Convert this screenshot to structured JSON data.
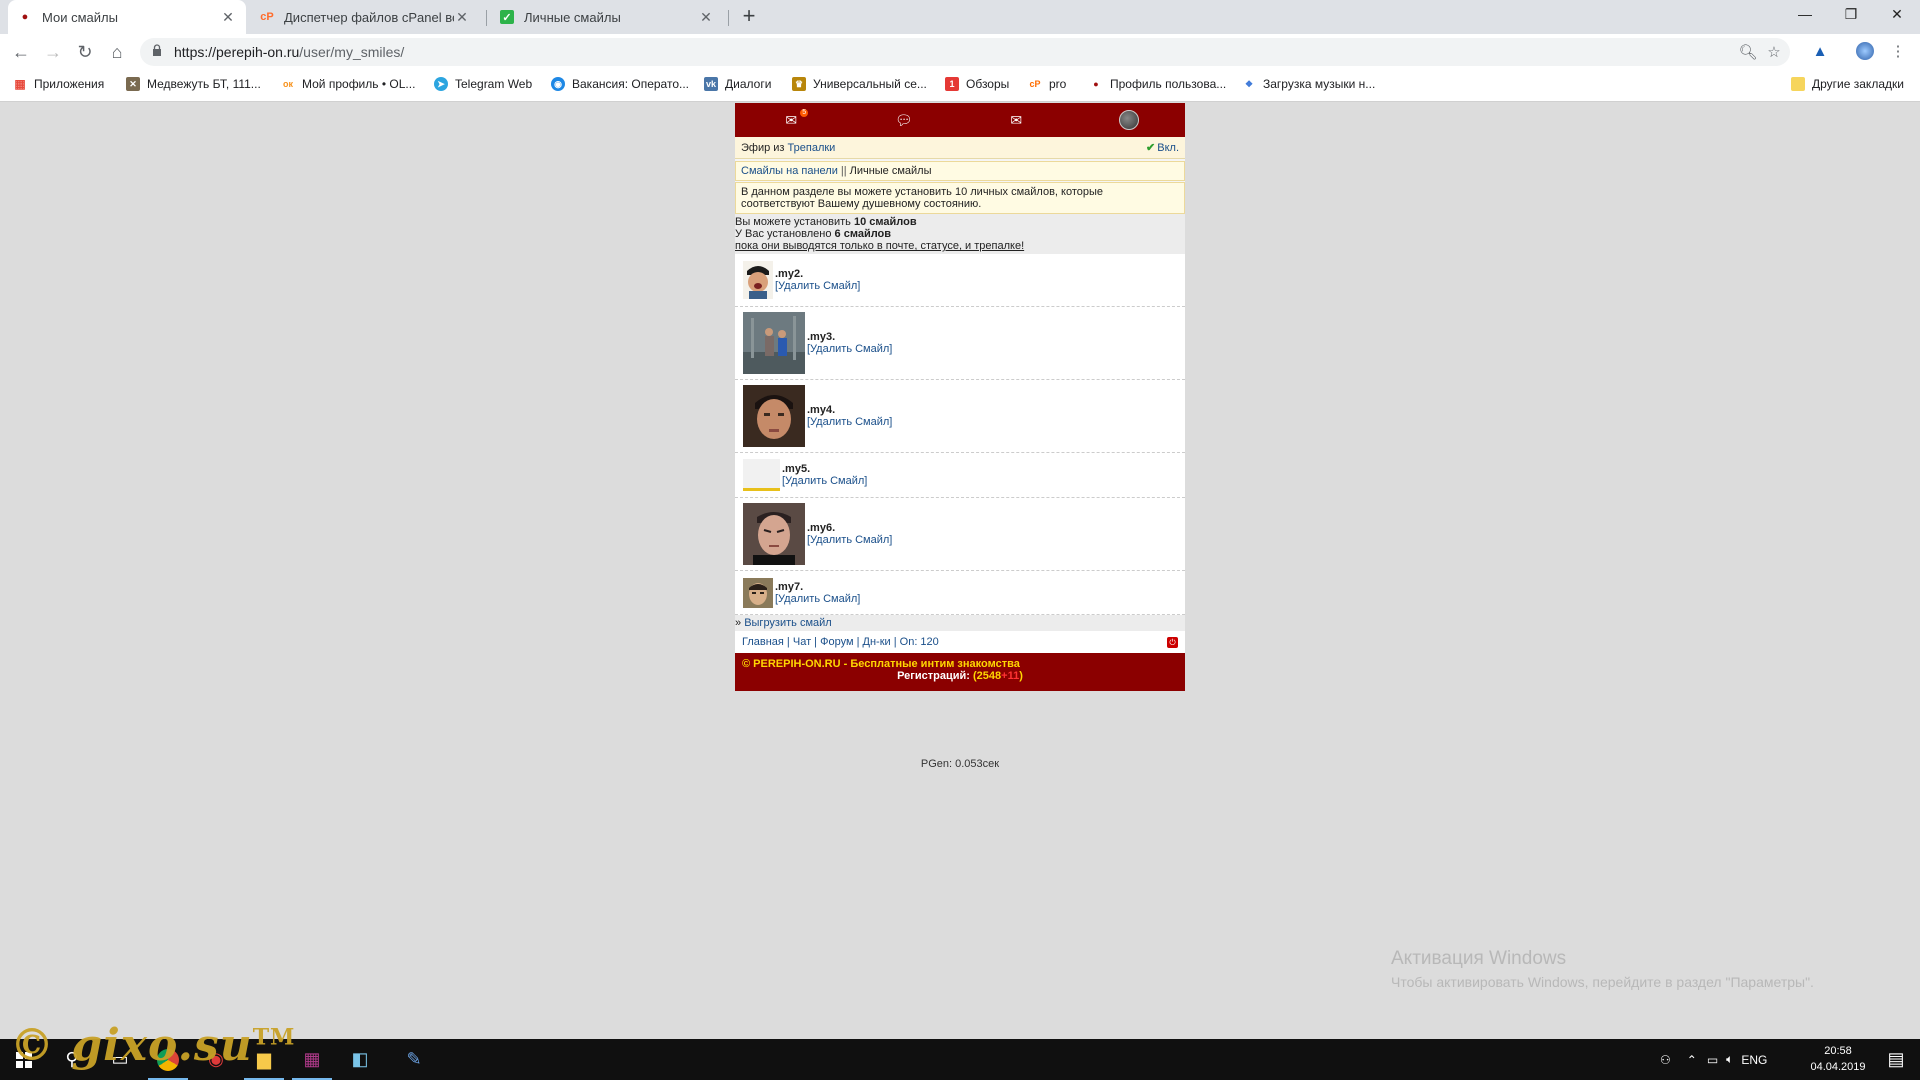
{
  "browser": {
    "tabs": [
      {
        "title": "Мои смайлы",
        "active": true
      },
      {
        "title": "Диспетчер файлов cPanel верси",
        "active": false
      },
      {
        "title": "Личные смайлы",
        "active": false
      }
    ],
    "new_tab": "+",
    "window_controls": {
      "minimize": "—",
      "restore": "❐",
      "close": "✕"
    },
    "url_host": "https://perepih-on.ru",
    "url_path": "/user/my_smiles/",
    "bookmarks": [
      {
        "label": "Приложения",
        "icon": "apps-icon",
        "color": "#e84a3c"
      },
      {
        "label": "Медвежуть БТ, 111...",
        "icon": "bear-icon",
        "color": "#7a6a50"
      },
      {
        "label": "Мой профиль • OL...",
        "icon": "ok-icon",
        "color": "#f7931e"
      },
      {
        "label": "Telegram Web",
        "icon": "telegram-icon",
        "color": "#2ca5e0"
      },
      {
        "label": "Вакансия: Операто...",
        "icon": "target-icon",
        "color": "#1e88e5"
      },
      {
        "label": "Диалоги",
        "icon": "vk-icon",
        "color": "#4a76a8"
      },
      {
        "label": "Универсальный се...",
        "icon": "emblem-icon",
        "color": "#b8860b"
      },
      {
        "label": "Обзоры",
        "icon": "review-icon",
        "color": "#e53935"
      },
      {
        "label": "pro",
        "icon": "pro-icon",
        "color": "#ff6d00"
      },
      {
        "label": "Профиль пользова...",
        "icon": "profile-icon",
        "color": "#a01010"
      },
      {
        "label": "Загрузка музыки н...",
        "icon": "music-icon",
        "color": "#3f7ad9"
      }
    ],
    "other_bookmarks": "Другие закладки"
  },
  "site": {
    "nav_badge": "5",
    "efir_prefix": "Эфир из",
    "efir_link": "Трепалки",
    "efir_status": "Вкл.",
    "crumb_1": "Смайлы на панели",
    "crumb_sep": "||",
    "crumb_2": "Личные смайлы",
    "info": "В данном разделе вы можете установить 10 личных смайлов, которые соответствуют Вашему душевному состоянию.",
    "can_install_prefix": "Вы можете установить",
    "can_install_value": "10 смайлов",
    "installed_prefix": "У Вас установлено",
    "installed_value": "6 смайлов",
    "note": "пока они выводятся только в почте, статусе, и трепалке!",
    "smiles": [
      {
        "code": ".my2.",
        "action": "[Удалить Смайл]",
        "image": "smile-crying-boy"
      },
      {
        "code": ".my3.",
        "action": "[Удалить Смайл]",
        "image": "smile-dancing"
      },
      {
        "code": ".my4.",
        "action": "[Удалить Смайл]",
        "image": "smile-face-man"
      },
      {
        "code": ".my5.",
        "action": "[Удалить Смайл]",
        "image": "smile-blank"
      },
      {
        "code": ".my6.",
        "action": "[Удалить Смайл]",
        "image": "smile-angry-man"
      },
      {
        "code": ".my7.",
        "action": "[Удалить Смайл]",
        "image": "smile-small-man"
      }
    ],
    "export_prefix": "»",
    "export_link": "Выгрузить смайл",
    "footer_links": [
      "Главная",
      "Чат",
      "Форум",
      "Дн-ки"
    ],
    "online": "Оn: 120",
    "copyright": "© PEREPIH-ON.RU - Бесплатные интим знакомства",
    "reg_prefix": "Регистраций:",
    "reg_open": "(",
    "reg_count": "2548",
    "reg_new": "+11",
    "reg_close": ")",
    "pgen": "PGen: 0.053сек"
  },
  "windows_activation": {
    "title": "Активация Windows",
    "subtitle": "Чтобы активировать Windows, перейдите в раздел \"Параметры\"."
  },
  "taskbar": {
    "lang": "ENG",
    "time": "20:58",
    "date": "04.04.2019"
  },
  "watermark": {
    "logo": "© gixo.su",
    "tm": "TM"
  }
}
